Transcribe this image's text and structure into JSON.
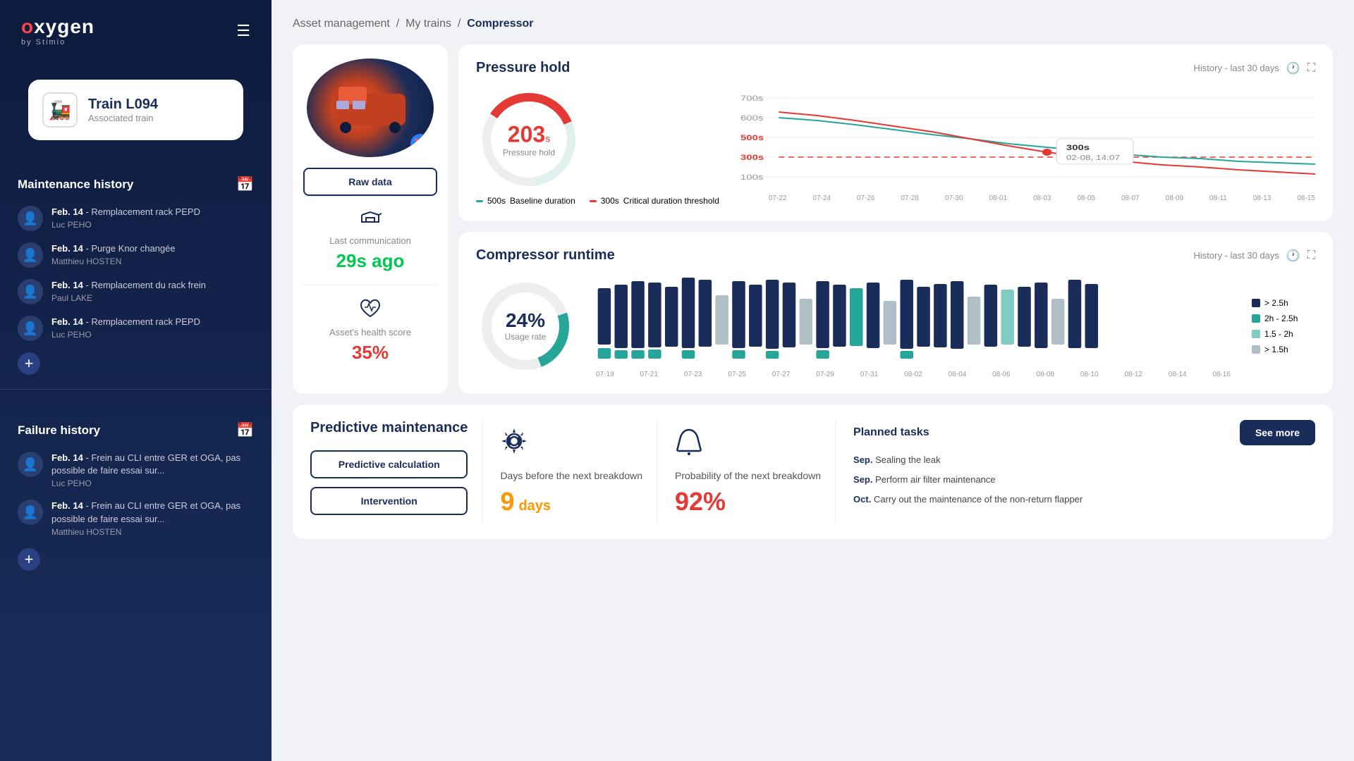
{
  "app": {
    "logo": "oxygen",
    "logo_brand": "by Stimio"
  },
  "sidebar": {
    "train_name": "Train L094",
    "train_sub": "Associated train",
    "maintenance_title": "Maintenance history",
    "maintenance_items": [
      {
        "date": "Feb. 14",
        "desc": "- Remplacement rack PEPD",
        "author": "Luc PEHO"
      },
      {
        "date": "Feb. 14",
        "desc": "- Purge Knor changée",
        "author": "Matthieu HOSTEN"
      },
      {
        "date": "Feb. 14",
        "desc": "- Remplacement du rack frein",
        "author": "Paul LAKE"
      },
      {
        "date": "Feb. 14",
        "desc": "- Remplacement rack PEPD",
        "author": "Luc PEHO"
      }
    ],
    "failure_title": "Failure history",
    "failure_items": [
      {
        "date": "Feb. 14",
        "desc": "- Frein au CLI entre GER et OGA, pas possible de faire essai sur...",
        "author": "Luc PEHO"
      },
      {
        "date": "Feb. 14",
        "desc": "- Frein au CLI entre GER et OGA, pas possible de faire essai sur...",
        "author": "Matthieu HOSTEN"
      }
    ]
  },
  "breadcrumb": {
    "asset": "Asset management",
    "trains": "My trains",
    "current": "Compressor"
  },
  "left_card": {
    "raw_data_label": "Raw data",
    "last_comm_label": "Last communication",
    "last_comm_value": "29s ago",
    "health_label": "Asset's health score",
    "health_value": "35%"
  },
  "pressure_hold": {
    "title": "Pressure hold",
    "history_label": "History - last 30 days",
    "gauge_value": "203",
    "gauge_unit": "s",
    "gauge_sub": "Pressure hold",
    "baseline_value": "500s",
    "baseline_label": "Baseline duration",
    "critical_value": "300s",
    "critical_label": "Critical duration threshold",
    "tooltip_value": "300s",
    "tooltip_date": "02-08, 14:07"
  },
  "compressor_runtime": {
    "title": "Compressor runtime",
    "history_label": "History - last 30 days",
    "donut_value": "24%",
    "usage_label": "Usage rate",
    "legend": [
      {
        "label": "> 2.5h",
        "color": "#1a2d5a"
      },
      {
        "label": "2h - 2.5h",
        "color": "#26a69a"
      },
      {
        "label": "1.5 - 2h",
        "color": "#80cbc4"
      },
      {
        "label": "> 1.5h",
        "color": "#b0bec5"
      }
    ]
  },
  "predictive": {
    "title": "Predictive maintenance",
    "calc_btn": "Predictive calculation",
    "intervention_btn": "Intervention",
    "days_icon": "gear",
    "days_label": "Days before the next breakdown",
    "days_value": "9",
    "days_unit": "days",
    "prob_icon": "bell",
    "prob_label": "Probability of the next breakdown",
    "prob_value": "92%",
    "tasks_title": "Planned tasks",
    "see_more": "See more",
    "tasks": [
      {
        "month": "Sep.",
        "desc": "Sealing the leak"
      },
      {
        "month": "Sep.",
        "desc": "Perform air filter maintenance"
      },
      {
        "month": "Oct.",
        "desc": "Carry out the maintenance of the non-return flapper"
      }
    ]
  }
}
